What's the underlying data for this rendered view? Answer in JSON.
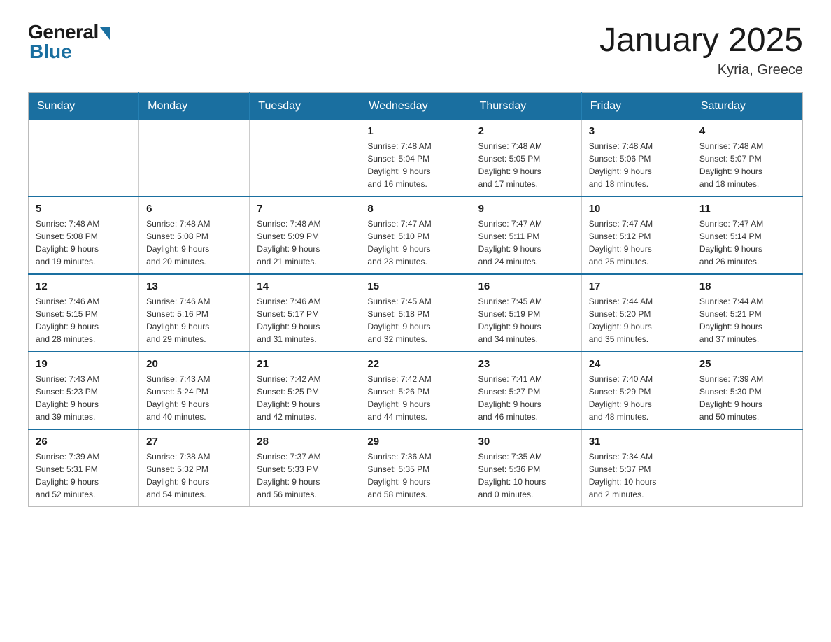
{
  "header": {
    "logo_general": "General",
    "logo_blue": "Blue",
    "month_title": "January 2025",
    "location": "Kyria, Greece"
  },
  "days_of_week": [
    "Sunday",
    "Monday",
    "Tuesday",
    "Wednesday",
    "Thursday",
    "Friday",
    "Saturday"
  ],
  "weeks": [
    [
      {
        "day": "",
        "info": ""
      },
      {
        "day": "",
        "info": ""
      },
      {
        "day": "",
        "info": ""
      },
      {
        "day": "1",
        "info": "Sunrise: 7:48 AM\nSunset: 5:04 PM\nDaylight: 9 hours\nand 16 minutes."
      },
      {
        "day": "2",
        "info": "Sunrise: 7:48 AM\nSunset: 5:05 PM\nDaylight: 9 hours\nand 17 minutes."
      },
      {
        "day": "3",
        "info": "Sunrise: 7:48 AM\nSunset: 5:06 PM\nDaylight: 9 hours\nand 18 minutes."
      },
      {
        "day": "4",
        "info": "Sunrise: 7:48 AM\nSunset: 5:07 PM\nDaylight: 9 hours\nand 18 minutes."
      }
    ],
    [
      {
        "day": "5",
        "info": "Sunrise: 7:48 AM\nSunset: 5:08 PM\nDaylight: 9 hours\nand 19 minutes."
      },
      {
        "day": "6",
        "info": "Sunrise: 7:48 AM\nSunset: 5:08 PM\nDaylight: 9 hours\nand 20 minutes."
      },
      {
        "day": "7",
        "info": "Sunrise: 7:48 AM\nSunset: 5:09 PM\nDaylight: 9 hours\nand 21 minutes."
      },
      {
        "day": "8",
        "info": "Sunrise: 7:47 AM\nSunset: 5:10 PM\nDaylight: 9 hours\nand 23 minutes."
      },
      {
        "day": "9",
        "info": "Sunrise: 7:47 AM\nSunset: 5:11 PM\nDaylight: 9 hours\nand 24 minutes."
      },
      {
        "day": "10",
        "info": "Sunrise: 7:47 AM\nSunset: 5:12 PM\nDaylight: 9 hours\nand 25 minutes."
      },
      {
        "day": "11",
        "info": "Sunrise: 7:47 AM\nSunset: 5:14 PM\nDaylight: 9 hours\nand 26 minutes."
      }
    ],
    [
      {
        "day": "12",
        "info": "Sunrise: 7:46 AM\nSunset: 5:15 PM\nDaylight: 9 hours\nand 28 minutes."
      },
      {
        "day": "13",
        "info": "Sunrise: 7:46 AM\nSunset: 5:16 PM\nDaylight: 9 hours\nand 29 minutes."
      },
      {
        "day": "14",
        "info": "Sunrise: 7:46 AM\nSunset: 5:17 PM\nDaylight: 9 hours\nand 31 minutes."
      },
      {
        "day": "15",
        "info": "Sunrise: 7:45 AM\nSunset: 5:18 PM\nDaylight: 9 hours\nand 32 minutes."
      },
      {
        "day": "16",
        "info": "Sunrise: 7:45 AM\nSunset: 5:19 PM\nDaylight: 9 hours\nand 34 minutes."
      },
      {
        "day": "17",
        "info": "Sunrise: 7:44 AM\nSunset: 5:20 PM\nDaylight: 9 hours\nand 35 minutes."
      },
      {
        "day": "18",
        "info": "Sunrise: 7:44 AM\nSunset: 5:21 PM\nDaylight: 9 hours\nand 37 minutes."
      }
    ],
    [
      {
        "day": "19",
        "info": "Sunrise: 7:43 AM\nSunset: 5:23 PM\nDaylight: 9 hours\nand 39 minutes."
      },
      {
        "day": "20",
        "info": "Sunrise: 7:43 AM\nSunset: 5:24 PM\nDaylight: 9 hours\nand 40 minutes."
      },
      {
        "day": "21",
        "info": "Sunrise: 7:42 AM\nSunset: 5:25 PM\nDaylight: 9 hours\nand 42 minutes."
      },
      {
        "day": "22",
        "info": "Sunrise: 7:42 AM\nSunset: 5:26 PM\nDaylight: 9 hours\nand 44 minutes."
      },
      {
        "day": "23",
        "info": "Sunrise: 7:41 AM\nSunset: 5:27 PM\nDaylight: 9 hours\nand 46 minutes."
      },
      {
        "day": "24",
        "info": "Sunrise: 7:40 AM\nSunset: 5:29 PM\nDaylight: 9 hours\nand 48 minutes."
      },
      {
        "day": "25",
        "info": "Sunrise: 7:39 AM\nSunset: 5:30 PM\nDaylight: 9 hours\nand 50 minutes."
      }
    ],
    [
      {
        "day": "26",
        "info": "Sunrise: 7:39 AM\nSunset: 5:31 PM\nDaylight: 9 hours\nand 52 minutes."
      },
      {
        "day": "27",
        "info": "Sunrise: 7:38 AM\nSunset: 5:32 PM\nDaylight: 9 hours\nand 54 minutes."
      },
      {
        "day": "28",
        "info": "Sunrise: 7:37 AM\nSunset: 5:33 PM\nDaylight: 9 hours\nand 56 minutes."
      },
      {
        "day": "29",
        "info": "Sunrise: 7:36 AM\nSunset: 5:35 PM\nDaylight: 9 hours\nand 58 minutes."
      },
      {
        "day": "30",
        "info": "Sunrise: 7:35 AM\nSunset: 5:36 PM\nDaylight: 10 hours\nand 0 minutes."
      },
      {
        "day": "31",
        "info": "Sunrise: 7:34 AM\nSunset: 5:37 PM\nDaylight: 10 hours\nand 2 minutes."
      },
      {
        "day": "",
        "info": ""
      }
    ]
  ]
}
